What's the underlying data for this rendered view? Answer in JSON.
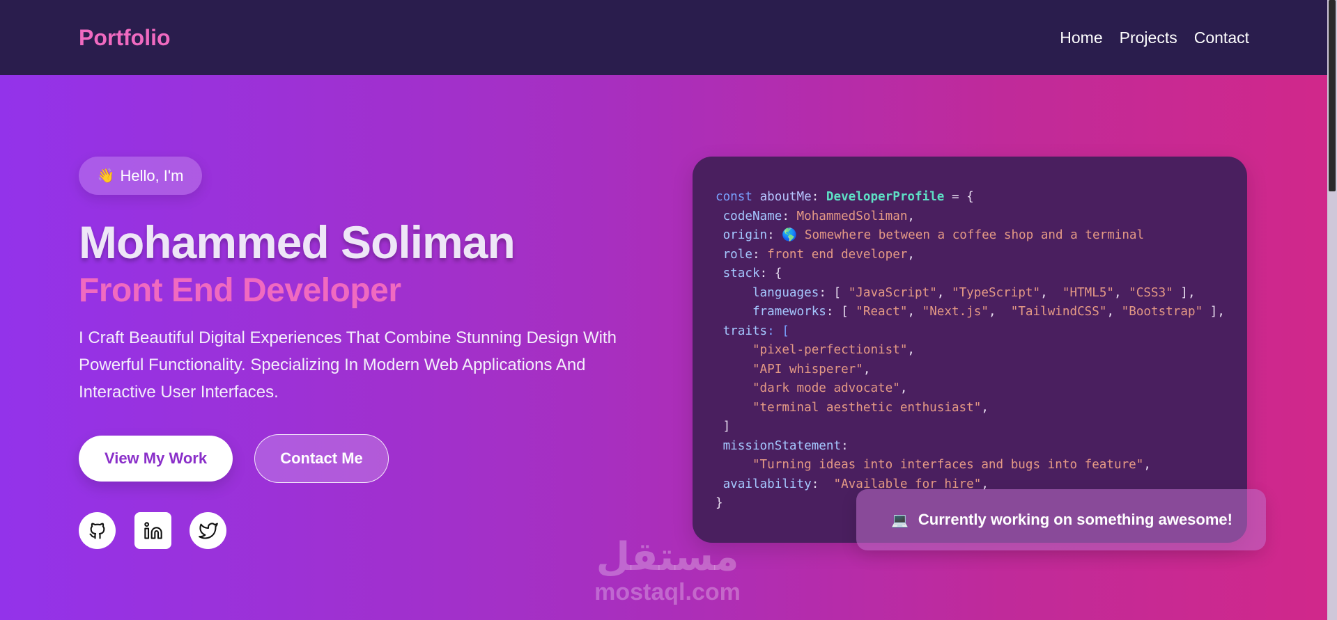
{
  "nav": {
    "brand": "Portfolio",
    "links": [
      "Home",
      "Projects",
      "Contact"
    ]
  },
  "hero": {
    "greeting_icon": "👋",
    "greeting": "Hello, I'm",
    "name": "Mohammed Soliman",
    "role": "Front End Developer",
    "description": "I Craft Beautiful Digital Experiences That Combine Stunning Design With Powerful Functionality. Specializing In Modern Web Applications And Interactive User Interfaces.",
    "primary_button": "View My Work",
    "secondary_button": "Contact Me",
    "social_icons": [
      "github-icon",
      "linkedin-icon",
      "twitter-icon"
    ]
  },
  "code": {
    "l1_kw": "const",
    "l1_var": "aboutMe",
    "l1_type": "DeveloperProfile",
    "l1_rest": " = {",
    "codeName_key": "codeName",
    "codeName_val": "MohammedSoliman",
    "origin_key": "origin",
    "origin_icon": "🌎",
    "origin_val": "Somewhere between a coffee shop and a terminal",
    "role_key": "role",
    "role_val": "front end developer",
    "stack_key": "stack",
    "languages_key": "languages",
    "languages": [
      "\"JavaScript\"",
      "\"TypeScript\"",
      "\"HTML5\"",
      "\"CSS3\""
    ],
    "frameworks_key": "frameworks",
    "frameworks": [
      "\"React\"",
      "\"Next.js\"",
      "\"TailwindCSS\"",
      "\"Bootstrap\""
    ],
    "traits_key": "traits",
    "traits": [
      "\"pixel-perfectionist\"",
      "\"API whisperer\"",
      "\"dark mode advocate\"",
      "\"terminal aesthetic enthusiast\""
    ],
    "mission_key": "missionStatement",
    "mission_val": "\"Turning ideas into interfaces and bugs into feature\"",
    "availability_key": "availability",
    "availability_val": "\"Available for hire\""
  },
  "toast": {
    "icon": "💻",
    "text": "Currently working on something awesome!"
  },
  "watermark": {
    "arabic": "مستقل",
    "latin": "mostaql.com"
  }
}
